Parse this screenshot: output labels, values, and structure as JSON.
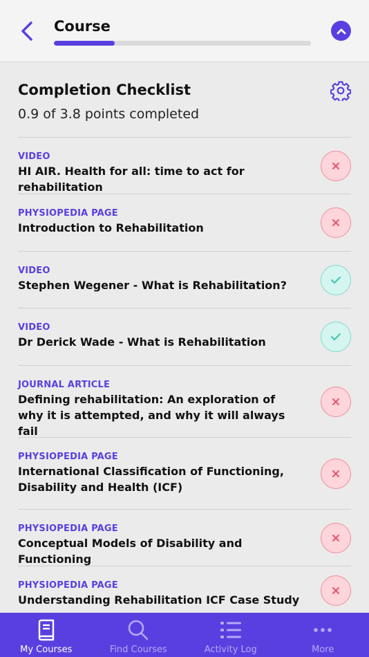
{
  "header": {
    "title": "Course",
    "progress": 0.237
  },
  "checklist": {
    "title": "Completion Checklist",
    "summary": "0.9 of 3.8 points completed"
  },
  "items": [
    {
      "type": "VIDEO",
      "title": "HI AIR. Health for all: time to act for rehabilitation",
      "status": "incomplete"
    },
    {
      "type": "PHYSIOPEDIA PAGE",
      "title": "Introduction to Rehabilitation",
      "status": "incomplete"
    },
    {
      "type": "VIDEO",
      "title": "Stephen Wegener - What is Rehabilitation?",
      "status": "complete"
    },
    {
      "type": "VIDEO",
      "title": "Dr Derick Wade - What is Rehabilitation",
      "status": "complete"
    },
    {
      "type": "JOURNAL ARTICLE",
      "title": "Defining rehabilitation: An exploration of why it is attempted, and why it will always fail",
      "status": "incomplete"
    },
    {
      "type": "PHYSIOPEDIA PAGE",
      "title": "International Classification of Functioning, Disability and Health (ICF)",
      "status": "incomplete"
    },
    {
      "type": "PHYSIOPEDIA PAGE",
      "title": "Conceptual Models of Disability and Functioning",
      "status": "incomplete"
    },
    {
      "type": "PHYSIOPEDIA PAGE",
      "title": "Understanding Rehabilitation ICF Case Study",
      "status": "incomplete"
    }
  ],
  "tabs": [
    {
      "label": "My Courses",
      "icon": "book-icon",
      "active": true
    },
    {
      "label": "Find Courses",
      "icon": "search-icon",
      "active": false
    },
    {
      "label": "Activity Log",
      "icon": "list-icon",
      "active": false
    },
    {
      "label": "More",
      "icon": "more-icon",
      "active": false
    }
  ],
  "colors": {
    "accent": "#5a3fe0",
    "incomplete": "#f08c9a",
    "complete": "#7fd8cb"
  }
}
